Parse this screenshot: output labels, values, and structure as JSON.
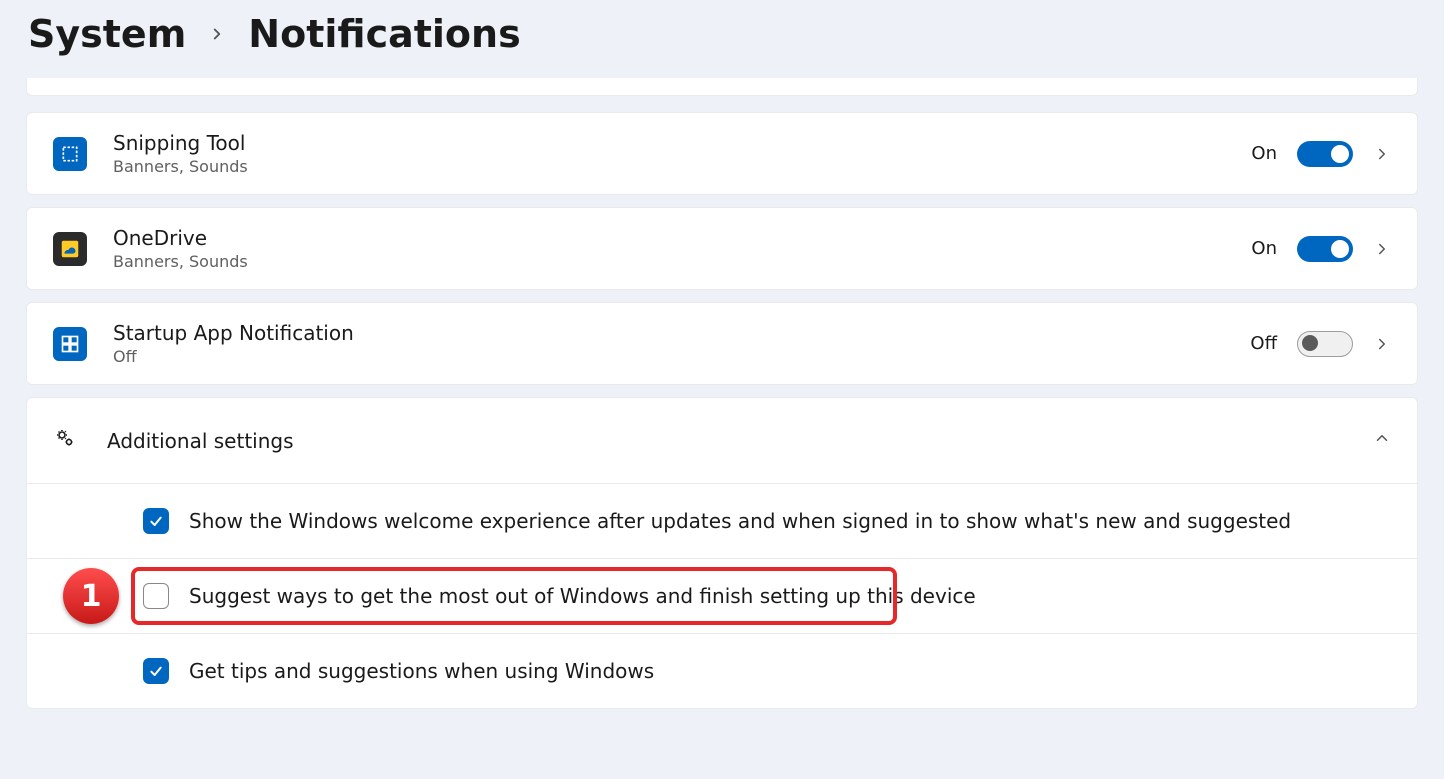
{
  "breadcrumb": {
    "parent": "System",
    "current": "Notifications"
  },
  "apps": [
    {
      "name": "Snipping Tool",
      "sub": "Banners, Sounds",
      "state": "On",
      "toggle": "on"
    },
    {
      "name": "OneDrive",
      "sub": "Banners, Sounds",
      "state": "On",
      "toggle": "on"
    },
    {
      "name": "Startup App Notification",
      "sub": "Off",
      "state": "Off",
      "toggle": "off"
    }
  ],
  "additional": {
    "title": "Additional settings",
    "options": [
      {
        "label": "Show the Windows welcome experience after updates and when signed in to show what's new and suggested",
        "checked": true,
        "highlight": false
      },
      {
        "label": "Suggest ways to get the most out of Windows and finish setting up this device",
        "checked": false,
        "highlight": true,
        "badge": "1"
      },
      {
        "label": "Get tips and suggestions when using Windows",
        "checked": true,
        "highlight": false
      }
    ]
  }
}
